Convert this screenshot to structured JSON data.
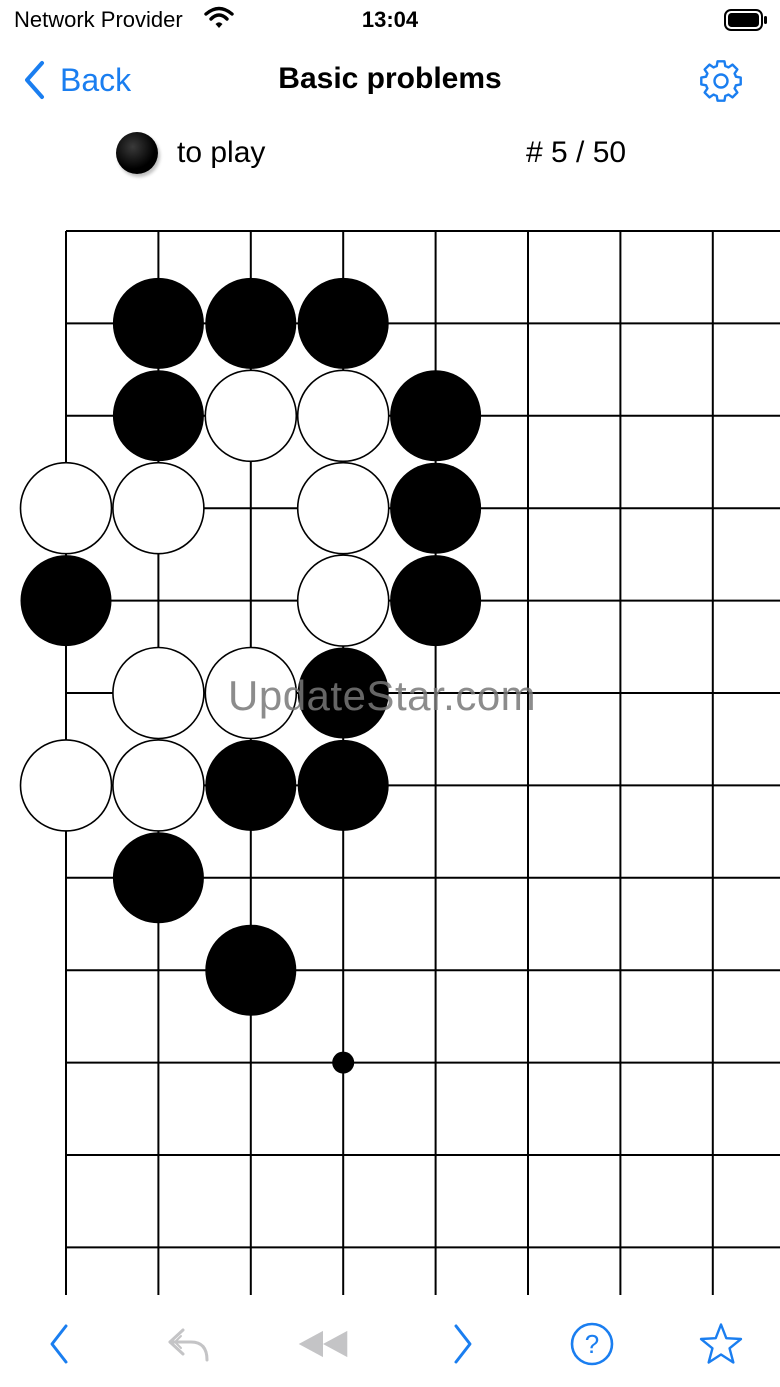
{
  "status_bar": {
    "carrier": "Network Provider",
    "time": "13:04"
  },
  "nav": {
    "back_label": "Back",
    "title": "Basic problems",
    "settings_icon": "gear-icon"
  },
  "info": {
    "to_play_label": "to play",
    "problem_counter": "# 5 / 50"
  },
  "board": {
    "visible_columns": 8,
    "visible_rows": 12,
    "star_points": [
      [
        3,
        9
      ]
    ],
    "stones": [
      {
        "color": "black",
        "col": 1,
        "row": 1
      },
      {
        "color": "black",
        "col": 2,
        "row": 1
      },
      {
        "color": "black",
        "col": 3,
        "row": 1
      },
      {
        "color": "black",
        "col": 1,
        "row": 2
      },
      {
        "color": "white",
        "col": 2,
        "row": 2
      },
      {
        "color": "white",
        "col": 3,
        "row": 2
      },
      {
        "color": "black",
        "col": 4,
        "row": 2
      },
      {
        "color": "white",
        "col": 0,
        "row": 3
      },
      {
        "color": "white",
        "col": 1,
        "row": 3
      },
      {
        "color": "white",
        "col": 3,
        "row": 3
      },
      {
        "color": "black",
        "col": 4,
        "row": 3
      },
      {
        "color": "black",
        "col": 0,
        "row": 4
      },
      {
        "color": "white",
        "col": 3,
        "row": 4
      },
      {
        "color": "black",
        "col": 4,
        "row": 4
      },
      {
        "color": "white",
        "col": 1,
        "row": 5
      },
      {
        "color": "white",
        "col": 2,
        "row": 5
      },
      {
        "color": "black",
        "col": 3,
        "row": 5
      },
      {
        "color": "white",
        "col": 0,
        "row": 6
      },
      {
        "color": "white",
        "col": 1,
        "row": 6
      },
      {
        "color": "black",
        "col": 2,
        "row": 6
      },
      {
        "color": "black",
        "col": 3,
        "row": 6
      },
      {
        "color": "black",
        "col": 1,
        "row": 7
      },
      {
        "color": "black",
        "col": 2,
        "row": 8
      }
    ]
  },
  "watermark": "UpdateStar.com",
  "toolbar": {
    "items": [
      {
        "icon": "chevron-left-icon",
        "enabled": true
      },
      {
        "icon": "undo-icon",
        "enabled": false
      },
      {
        "icon": "rewind-icon",
        "enabled": false
      },
      {
        "icon": "chevron-right-icon",
        "enabled": true
      },
      {
        "icon": "help-icon",
        "label": "?",
        "enabled": true
      },
      {
        "icon": "star-icon",
        "enabled": true
      }
    ]
  },
  "colors": {
    "accent": "#1a7ef0",
    "disabled": "#c4c4c6"
  }
}
